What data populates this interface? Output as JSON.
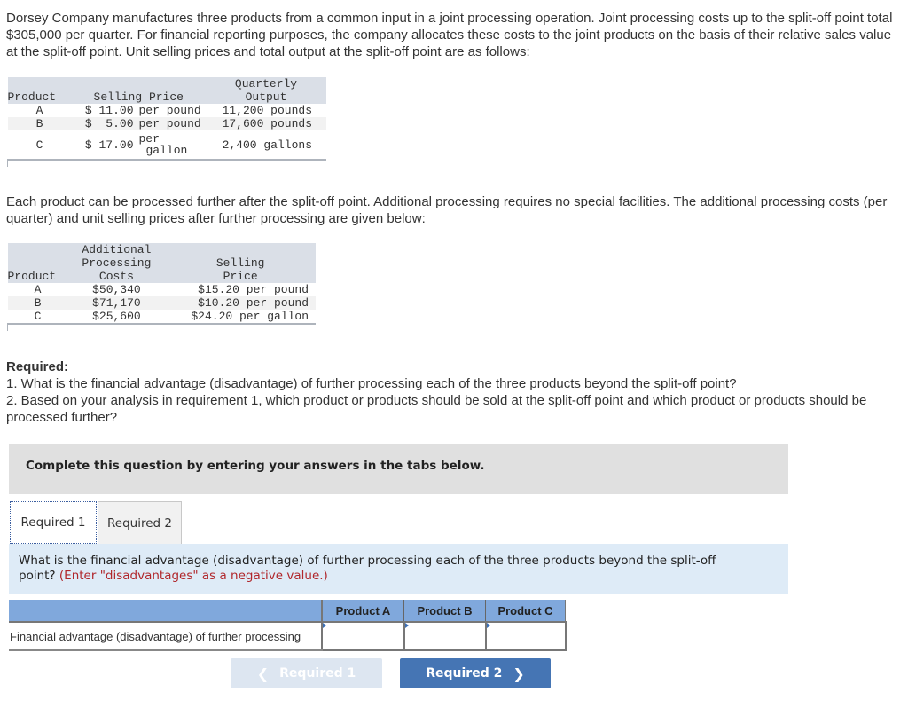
{
  "intro": "Dorsey Company manufactures three products from a common input in a joint processing operation. Joint processing costs up to the split-off point total $305,000 per quarter. For financial reporting purposes, the company allocates these costs to the joint products on the basis of their relative sales value at the split-off point. Unit selling prices and total output at the split-off point are as follows:",
  "table1": {
    "headers": [
      "Product",
      "Selling Price",
      "Quarterly Output"
    ],
    "header_output_line1": "Quarterly",
    "header_output_line2": "Output",
    "rows": [
      {
        "product": "A",
        "price": "$ 11.00",
        "unit": "per pound",
        "output": "11,200 pounds"
      },
      {
        "product": "B",
        "price": "$  5.00",
        "unit": "per pound",
        "output": "17,600 pounds"
      },
      {
        "product": "C",
        "price": "$ 17.00",
        "unit_line1": "per",
        "unit_line2": "gallon",
        "output": "2,400 gallons"
      }
    ]
  },
  "further": "Each product can be processed further after the split-off point. Additional processing requires no special facilities. The additional processing costs (per quarter) and unit selling prices after further processing are given below:",
  "table2": {
    "header_cost_line1": "Additional",
    "header_cost_line2": "Processing",
    "header_cost_line3": "Costs",
    "header_price_line1": "Selling",
    "header_price_line2": "Price",
    "header_product": "Product",
    "rows": [
      {
        "product": "A",
        "cost": "$50,340",
        "price": "$15.20 per pound"
      },
      {
        "product": "B",
        "cost": "$71,170",
        "price": "$10.20 per pound"
      },
      {
        "product": "C",
        "cost": "$25,600",
        "price": "$24.20 per gallon"
      }
    ]
  },
  "required": {
    "title": "Required:",
    "q1": "1. What is the financial advantage (disadvantage) of further processing each of the three products beyond the split-off point?",
    "q2": "2. Based on your analysis in requirement 1, which product or products should be sold at the split-off point and which product or products should be processed further?"
  },
  "panel_text": "Complete this question by entering your answers in the tabs below.",
  "tabs": [
    {
      "label": "Required 1",
      "active": true
    },
    {
      "label": "Required 2",
      "active": false
    }
  ],
  "instruction": {
    "text": "What is the financial advantage (disadvantage) of further processing each of the three products beyond the split-off point?",
    "hint": "(Enter \"disadvantages\" as a negative value.)"
  },
  "answer_table": {
    "columns": [
      "Product A",
      "Product B",
      "Product C"
    ],
    "row_label": "Financial advantage (disadvantage) of further processing",
    "values": [
      "",
      "",
      ""
    ]
  },
  "nav": {
    "prev_label": "Required 1",
    "next_label": "Required 2",
    "prev_icon": "chevron-left-icon",
    "next_icon": "chevron-right-icon"
  },
  "colors": {
    "header_gray": "#dadfe7",
    "panel_gray": "#e0e0e0",
    "instruction_bg": "#deebf7",
    "hint_red": "#b0262b",
    "answer_header": "#80a8dc",
    "next_button": "#4575b4",
    "prev_button_disabled": "#dde6f1"
  }
}
